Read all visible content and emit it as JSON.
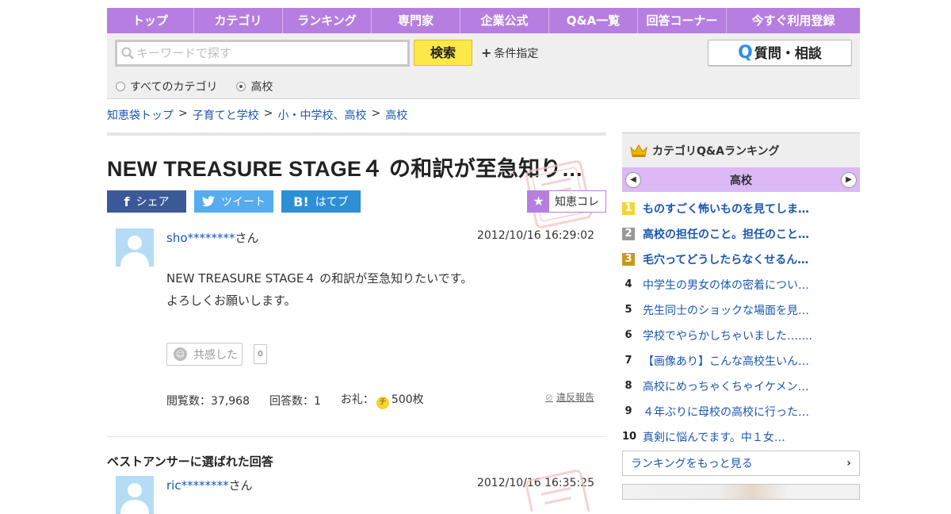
{
  "nav": {
    "items": [
      {
        "label": "トップ",
        "w": 110
      },
      {
        "label": "カテゴリ",
        "w": 112
      },
      {
        "label": "ランキング",
        "w": 112
      },
      {
        "label": "専門家",
        "w": 112
      },
      {
        "label": "企業公式",
        "w": 112
      },
      {
        "label": "Q&A一覧",
        "w": 112
      },
      {
        "label": "回答コーナー",
        "w": 112
      },
      {
        "label": "今すぐ利用登録",
        "w": 168
      }
    ]
  },
  "search": {
    "placeholder": "キーワードで探す",
    "button_label": "検索",
    "conditions_label": "条件指定",
    "ask_label": "質問・相談",
    "ask_q": "Q",
    "scope_all": "すべてのカテゴリ",
    "scope_current": "高校"
  },
  "breadcrumb": {
    "items": [
      "知恵袋トップ",
      "子育てと学校",
      "小・中学校、高校",
      "高校"
    ],
    "separator": ">"
  },
  "question": {
    "title": "NEW TREASURE STAGE４ の和訳が至急知り…",
    "share_facebook": "シェア",
    "share_twitter": "ツイート",
    "share_hatena": "はてブ",
    "chiekore": "知恵コレ",
    "user": "sho********",
    "user_suffix": "さん",
    "date": "2012/10/16  16:29:02",
    "body_line1": "NEW TREASURE STAGE４ の和訳が至急知りたいです。",
    "body_line2": "よろしくお願いします。",
    "empathy_label": "共感した",
    "empathy_count": "0",
    "views_label": "閲覧数：37,968",
    "answers_label": "回答数：1",
    "reward_label": "お礼：",
    "reward_value": "500枚",
    "coin": "チ",
    "report_label": "違反報告"
  },
  "best_answer": {
    "heading": "ベストアンサーに選ばれた回答",
    "user": "ric********",
    "user_suffix": "さん",
    "date": "2012/10/16  16:35:25"
  },
  "ranking": {
    "title": "カテゴリQ&Aランキング",
    "category": "高校",
    "items": [
      {
        "num": "1",
        "text": "ものすごく怖いものを見てしま…"
      },
      {
        "num": "2",
        "text": "高校の担任のこと。担任のこと…"
      },
      {
        "num": "3",
        "text": "毛穴ってどうしたらなくせるん…"
      },
      {
        "num": "4",
        "text": "中学生の男女の体の密着につい…"
      },
      {
        "num": "5",
        "text": "先生同士のショックな場面を見…"
      },
      {
        "num": "6",
        "text": "学校でやらかしちゃいました‥‥..."
      },
      {
        "num": "7",
        "text": "【画像あり】こんな高校生いん…"
      },
      {
        "num": "8",
        "text": "高校にめっちゃくちゃイケメン…"
      },
      {
        "num": "9",
        "text": "４年ぶりに母校の高校に行った…"
      },
      {
        "num": "10",
        "text": "真剣に悩んでます。中１女…"
      }
    ],
    "more_label": "ランキングをもっと見る"
  },
  "colors": {
    "nav_purple": "#b67ee0",
    "link_blue": "#1a56b0",
    "search_yellow": "#fde84a"
  }
}
